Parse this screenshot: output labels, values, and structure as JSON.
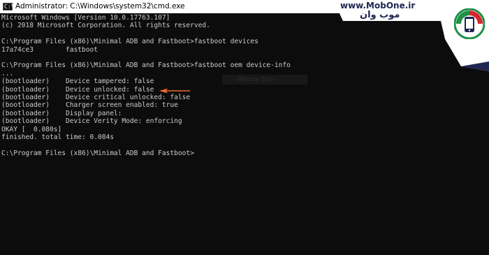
{
  "window": {
    "title": "Administrator: C:\\Windows\\system32\\cmd.exe",
    "icon": "cmd-icon",
    "icon_glyph": "C:\\"
  },
  "console": {
    "lines": [
      "Microsoft Windows [Version 10.0.17763.107]",
      "(c) 2018 Microsoft Corporation. All rights reserved.",
      "",
      "C:\\Program Files (x86)\\Minimal ADB and Fastboot>fastboot devices",
      "17a74ce3        fastboot",
      "",
      "C:\\Program Files (x86)\\Minimal ADB and Fastboot>fastboot oem device-info",
      "...",
      "(bootloader)    Device tampered: false",
      "(bootloader)    Device unlocked: false",
      "(bootloader)    Device critical unlocked: false",
      "(bootloader)    Charger screen enabled: true",
      "(bootloader)    Display panel:",
      "(bootloader)    Device Verity Mode: enforcing",
      "OKAY [  0.080s]",
      "finished. total time: 0.084s",
      "",
      "C:\\Program Files (x86)\\Minimal ADB and Fastboot>"
    ],
    "ghost_text": "Window Snip",
    "arrow_color": "#f06b2c",
    "text_color": "#cccccc",
    "background": "#0c0c0c"
  },
  "watermark": {
    "url": "www.MobOne.ir",
    "name": "موب وان",
    "logo_icon": "mobone-phone-logo-icon",
    "accent": "#1d2552"
  }
}
